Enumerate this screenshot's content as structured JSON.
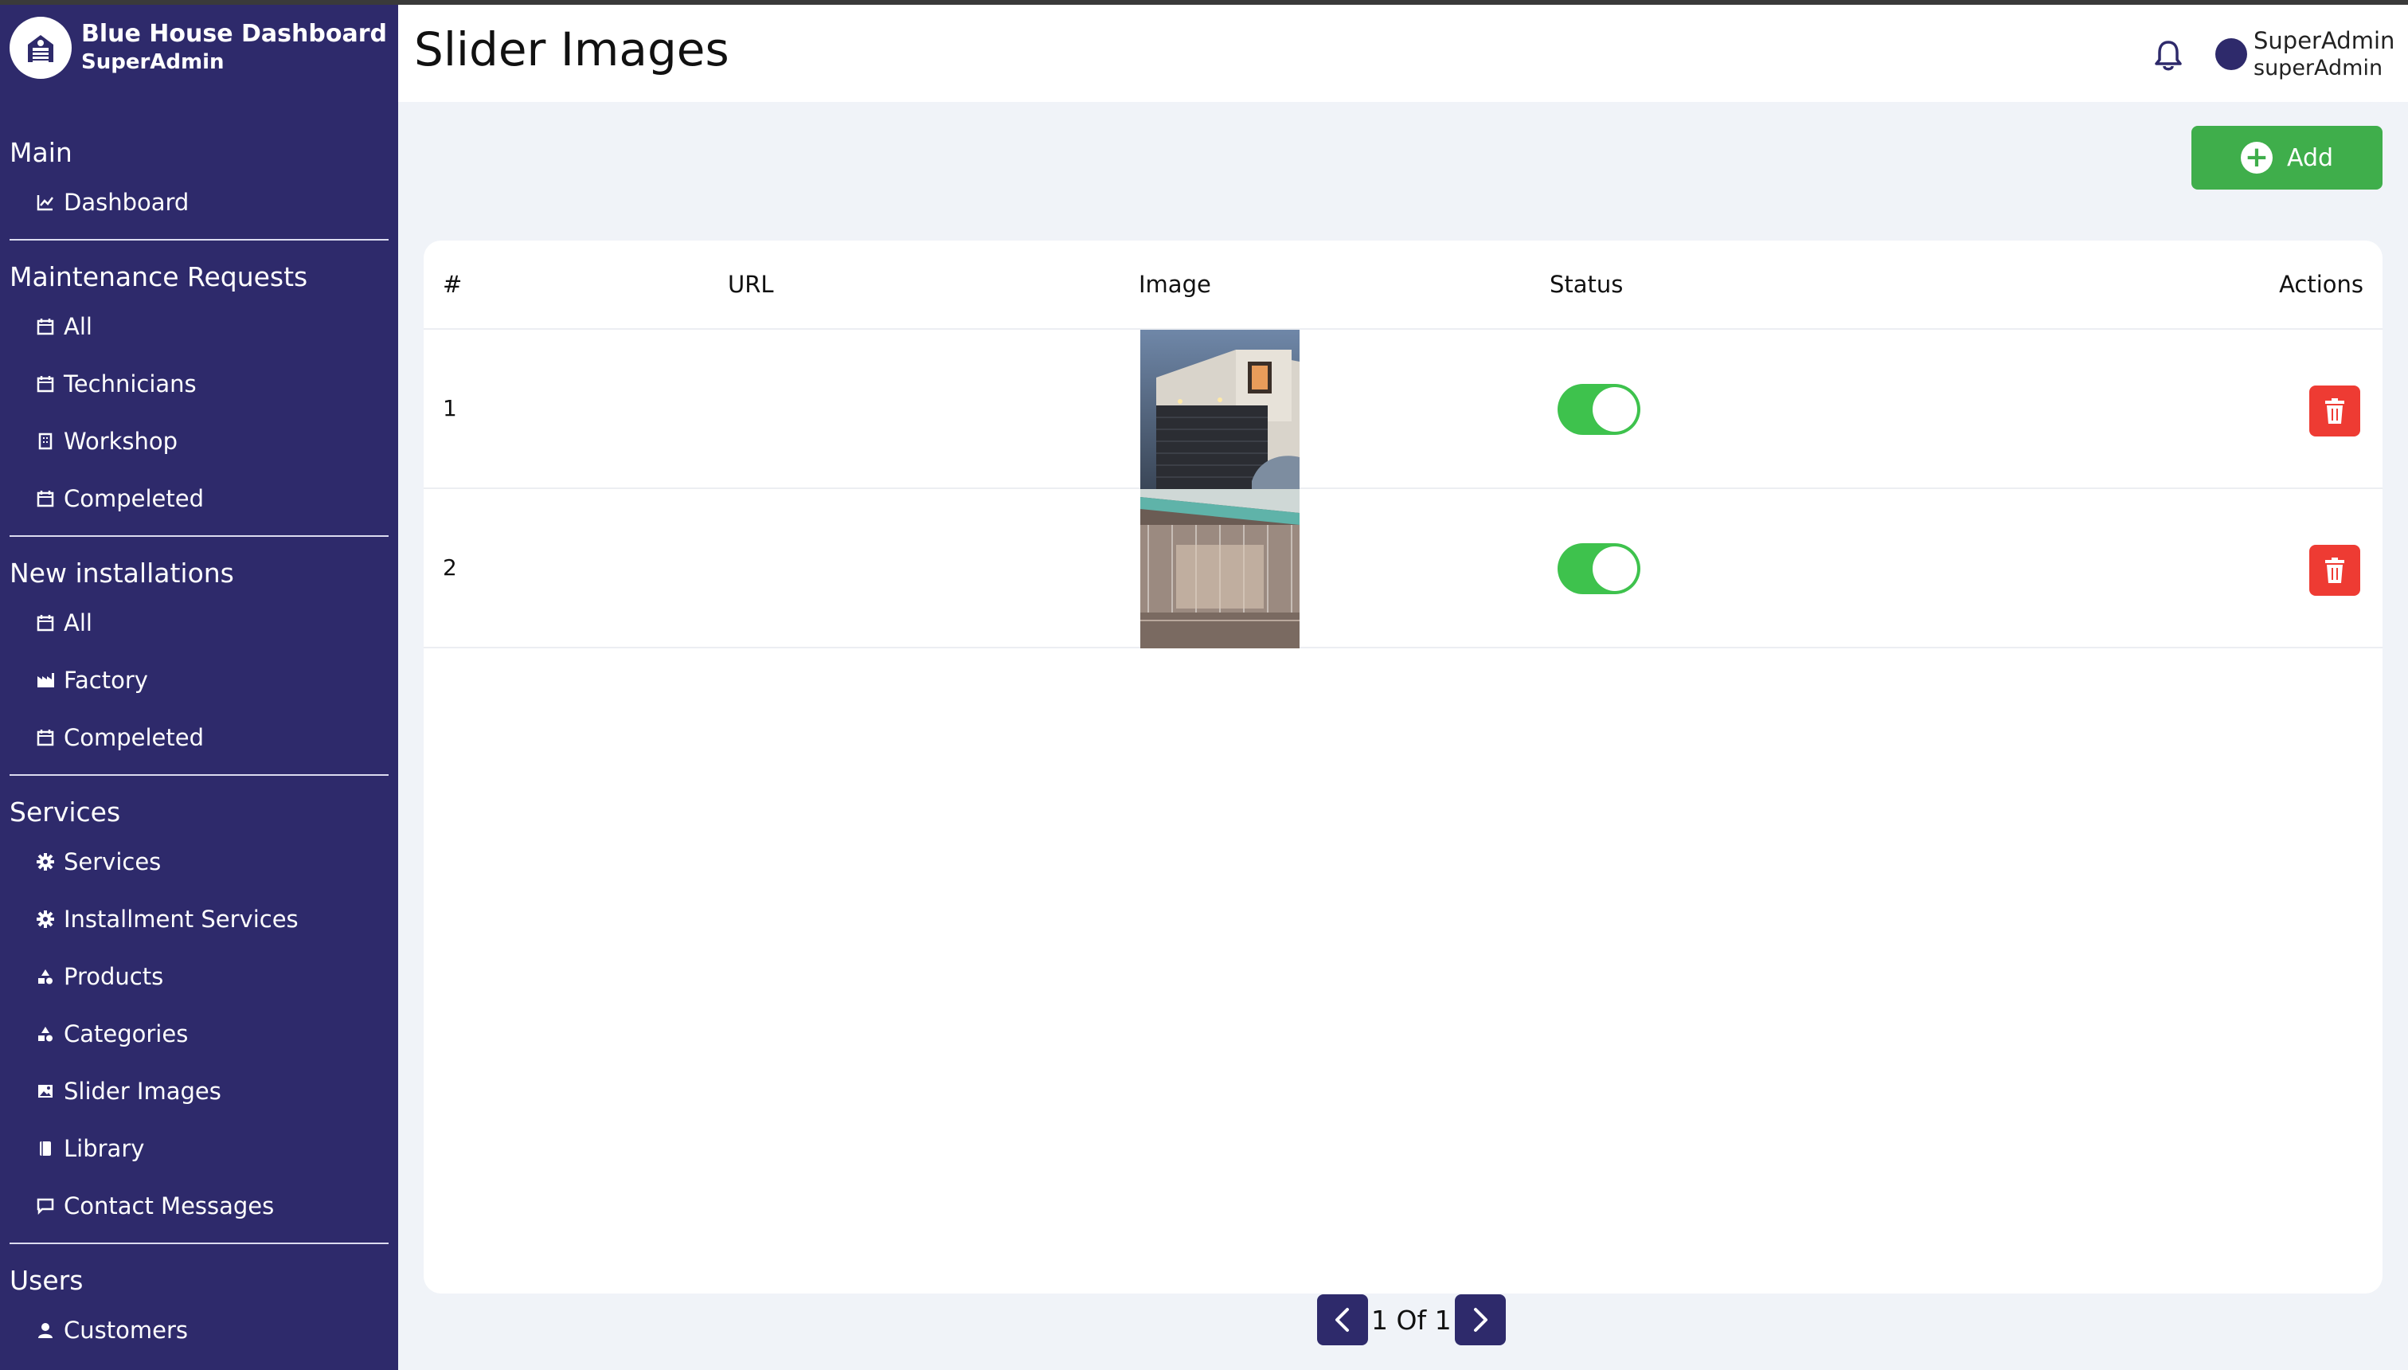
{
  "brand": {
    "title": "Blue House Dashboard",
    "subtitle": "SuperAdmin"
  },
  "sidebar": {
    "sections": [
      {
        "title": "Main",
        "items": [
          {
            "label": "Dashboard",
            "icon": "chart-icon"
          }
        ]
      },
      {
        "title": "Maintenance Requests",
        "items": [
          {
            "label": "All",
            "icon": "calendar-icon"
          },
          {
            "label": "Technicians",
            "icon": "calendar-icon"
          },
          {
            "label": "Workshop",
            "icon": "building-icon"
          },
          {
            "label": "Compeleted",
            "icon": "calendar-icon"
          }
        ]
      },
      {
        "title": "New installations",
        "items": [
          {
            "label": "All",
            "icon": "calendar-icon"
          },
          {
            "label": "Factory",
            "icon": "factory-icon"
          },
          {
            "label": "Compeleted",
            "icon": "calendar-icon"
          }
        ]
      },
      {
        "title": "Services",
        "items": [
          {
            "label": "Services",
            "icon": "gear-icon"
          },
          {
            "label": "Installment Services",
            "icon": "gear-icon"
          },
          {
            "label": "Products",
            "icon": "shapes-icon"
          },
          {
            "label": "Categories",
            "icon": "shapes-icon"
          },
          {
            "label": "Slider Images",
            "icon": "image-icon"
          },
          {
            "label": "Library",
            "icon": "book-icon"
          },
          {
            "label": "Contact Messages",
            "icon": "message-icon"
          }
        ]
      },
      {
        "title": "Users",
        "items": [
          {
            "label": "Customers",
            "icon": "user-icon"
          }
        ]
      }
    ]
  },
  "header": {
    "title": "Slider Images",
    "user_name": "SuperAdmin",
    "user_role": "superAdmin"
  },
  "toolbar": {
    "add_label": "Add"
  },
  "table": {
    "columns": [
      "#",
      "URL",
      "Image",
      "Status",
      "Actions"
    ],
    "rows": [
      {
        "index": "1",
        "url": "",
        "status": true
      },
      {
        "index": "2",
        "url": "",
        "status": true
      }
    ]
  },
  "pagination": {
    "text": "1 Of 1"
  },
  "colors": {
    "sidebar": "#2e2a6b",
    "accent_green": "#3fae4b",
    "danger": "#ee3b33",
    "toggle_on": "#3ec24d"
  }
}
